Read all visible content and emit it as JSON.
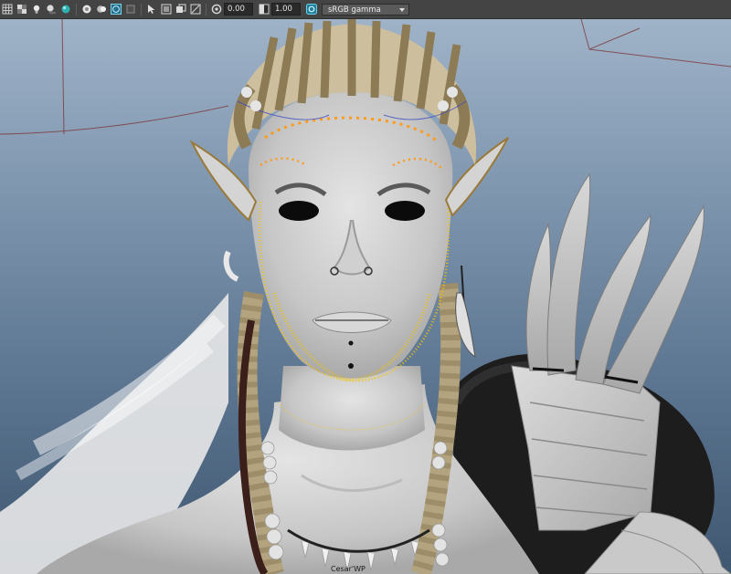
{
  "toolbar": {
    "icons": [
      "grid-icon",
      "checker-icon",
      "light-icon",
      "shadow-icon",
      "ambient-occlusion-icon",
      "isolate-icon",
      "xray-icon",
      "wireframe-icon",
      "backface-icon",
      "select-icon",
      "smooth-icon",
      "texture-icon",
      "resolution-icon",
      "exposure-icon",
      "gamma-icon",
      "color-management-icon"
    ],
    "exposure_value": "0.00",
    "gamma_value": "1.00",
    "colorspace_label": "sRGB gamma"
  },
  "viewport": {
    "hud_label": "Cesar'WP",
    "background_top": "#9fb3c8",
    "background_bottom": "#3f5771",
    "grid_color": "#7a3030",
    "selection_highlight": "#f5c400",
    "active_highlight": "#ff9a1a"
  }
}
